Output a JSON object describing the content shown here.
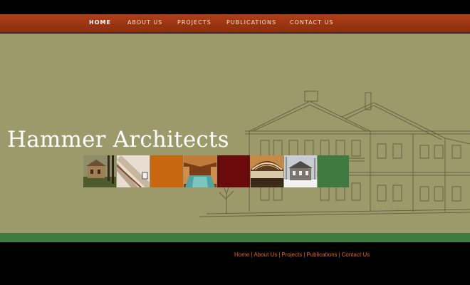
{
  "nav": {
    "items": [
      {
        "label": "HOME",
        "active": true
      },
      {
        "label": "ABOUT US"
      },
      {
        "label": "PROJECTS"
      },
      {
        "label": "PUBLICATIONS"
      },
      {
        "label": "CONTACT US"
      }
    ]
  },
  "hero": {
    "title": "Hammer Architects"
  },
  "tiles": [
    {
      "type": "photo",
      "subject": "building-exterior-trees"
    },
    {
      "type": "photo",
      "subject": "interior-staircase"
    },
    {
      "type": "color",
      "color": "#c8670f"
    },
    {
      "type": "photo",
      "subject": "indoor-pool"
    },
    {
      "type": "color",
      "color": "#6b0a0a"
    },
    {
      "type": "photo",
      "subject": "vaulted-interior-wood-ceiling"
    },
    {
      "type": "photo",
      "subject": "house-in-snow"
    },
    {
      "type": "color",
      "color": "#3f7a41"
    }
  ],
  "footer": {
    "links": [
      {
        "label": "Home"
      },
      {
        "label": "About Us"
      },
      {
        "label": "Projects"
      },
      {
        "label": "Publications"
      },
      {
        "label": "Contact Us"
      }
    ],
    "separator": "|"
  },
  "colors": {
    "nav_bg": "#9a3412",
    "hero_bg": "#9c9a6b",
    "accent_green": "#3f7a41",
    "footer_link": "#e0641e"
  }
}
